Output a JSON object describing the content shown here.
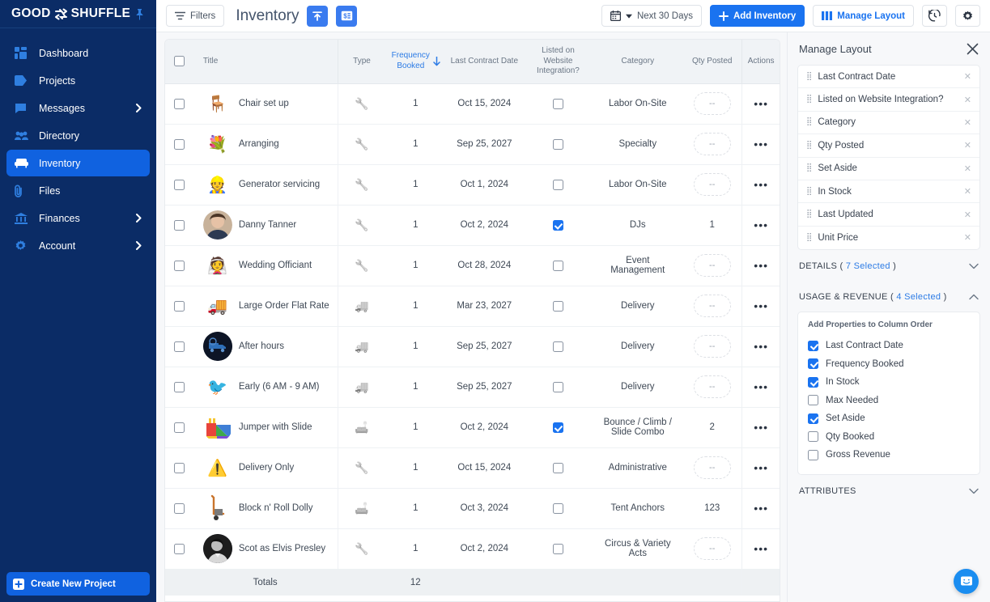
{
  "sidebar": {
    "brand": {
      "word1": "GOOD",
      "word2": "SHUFFLE",
      "pin_icon": "pin-icon"
    },
    "items": [
      {
        "label": "Dashboard",
        "icon": "dashboard-icon",
        "active": false,
        "chevron": false
      },
      {
        "label": "Projects",
        "icon": "tag-icon",
        "active": false,
        "chevron": false
      },
      {
        "label": "Messages",
        "icon": "message-icon",
        "active": false,
        "chevron": true
      },
      {
        "label": "Directory",
        "icon": "people-icon",
        "active": false,
        "chevron": true
      },
      {
        "label": "Inventory",
        "icon": "sofa-icon",
        "active": true,
        "chevron": false
      },
      {
        "label": "Files",
        "icon": "paperclip-icon",
        "active": false,
        "chevron": false
      },
      {
        "label": "Finances",
        "icon": "bank-icon",
        "active": false,
        "chevron": true
      },
      {
        "label": "Account",
        "icon": "gear-icon",
        "active": false,
        "chevron": true
      }
    ],
    "create_button": {
      "label": "Create New Project",
      "icon": "plus-square-icon"
    }
  },
  "topbar": {
    "filters_label": "Filters",
    "filters_icon": "filter-icon",
    "page_title": "Inventory",
    "export_icon": "upload-export-icon",
    "pricing_icon": "price-card-icon",
    "date_range_label": "Next 30 Days",
    "calendar_icon": "calendar-icon",
    "caret_icon": "caret-down-icon",
    "add_inventory_label": "Add Inventory",
    "add_icon": "plus-icon",
    "manage_layout_label": "Manage Layout",
    "manage_layout_icon": "columns-icon",
    "history_icon": "history-clock-icon",
    "settings_icon": "gear-icon"
  },
  "table": {
    "select_all_checked": false,
    "columns": [
      {
        "key": "select",
        "label": ""
      },
      {
        "key": "title",
        "label": "Title"
      },
      {
        "key": "type",
        "label": "Type"
      },
      {
        "key": "frequency_booked",
        "label": "Frequency Booked",
        "sorted": true,
        "sort_dir": "desc"
      },
      {
        "key": "last_contract_date",
        "label": "Last Contract Date"
      },
      {
        "key": "listed_on_website",
        "label": "Listed on Website Integration?"
      },
      {
        "key": "category",
        "label": "Category"
      },
      {
        "key": "qty_posted",
        "label": "Qty Posted"
      },
      {
        "key": "actions",
        "label": "Actions"
      }
    ],
    "rows": [
      {
        "selected": false,
        "thumb": "chair-icon",
        "thumb_style": "plain",
        "title": "Chair set up",
        "type_icon": "wrench-icon",
        "frequency_booked": "1",
        "last_contract_date": "Oct 15, 2024",
        "listed": false,
        "category": "Labor On-Site",
        "qty_posted": "--",
        "qty_empty": true
      },
      {
        "selected": false,
        "thumb": "flower-arranging-icon",
        "thumb_style": "plain",
        "title": "Arranging",
        "type_icon": "wrench-icon",
        "frequency_booked": "1",
        "last_contract_date": "Sep 25, 2027",
        "listed": false,
        "category": "Specialty",
        "qty_posted": "--",
        "qty_empty": true
      },
      {
        "selected": false,
        "thumb": "worker-wrench-icon",
        "thumb_style": "plain",
        "title": "Generator servicing",
        "type_icon": "wrench-icon",
        "frequency_booked": "1",
        "last_contract_date": "Oct 1, 2024",
        "listed": false,
        "category": "Labor On-Site",
        "qty_posted": "--",
        "qty_empty": true
      },
      {
        "selected": false,
        "thumb": "person-photo-icon",
        "thumb_style": "photo",
        "title": "Danny Tanner",
        "type_icon": "wrench-icon",
        "frequency_booked": "1",
        "last_contract_date": "Oct 2, 2024",
        "listed": true,
        "category": "DJs",
        "qty_posted": "1",
        "qty_empty": false
      },
      {
        "selected": false,
        "thumb": "wedding-couple-icon",
        "thumb_style": "plain",
        "title": "Wedding Officiant",
        "type_icon": "wrench-icon",
        "frequency_booked": "1",
        "last_contract_date": "Oct 28, 2024",
        "listed": false,
        "category": "Event Management",
        "qty_posted": "--",
        "qty_empty": true
      },
      {
        "selected": false,
        "thumb": "truck-icon",
        "thumb_style": "plain",
        "title": "Large Order Flat Rate",
        "type_icon": "delivery-truck-icon",
        "frequency_booked": "1",
        "last_contract_date": "Mar 23, 2027",
        "listed": false,
        "category": "Delivery",
        "qty_posted": "--",
        "qty_empty": true
      },
      {
        "selected": false,
        "thumb": "night-truck-icon",
        "thumb_style": "dark",
        "title": "After hours",
        "type_icon": "delivery-truck-icon",
        "frequency_booked": "1",
        "last_contract_date": "Sep 25, 2027",
        "listed": false,
        "category": "Delivery",
        "qty_posted": "--",
        "qty_empty": true
      },
      {
        "selected": false,
        "thumb": "early-bird-icon",
        "thumb_style": "plain",
        "title": "Early (6 AM - 9 AM)",
        "type_icon": "delivery-truck-icon",
        "frequency_booked": "1",
        "last_contract_date": "Sep 25, 2027",
        "listed": false,
        "category": "Delivery",
        "qty_posted": "--",
        "qty_empty": true
      },
      {
        "selected": false,
        "thumb": "bounce-house-icon",
        "thumb_style": "plain",
        "title": "Jumper with Slide",
        "type_icon": "furniture-icon",
        "frequency_booked": "1",
        "last_contract_date": "Oct 2, 2024",
        "listed": true,
        "category": "Bounce / Climb / Slide Combo",
        "qty_posted": "2",
        "qty_empty": false
      },
      {
        "selected": false,
        "thumb": "warning-icon",
        "thumb_style": "plain",
        "title": "Delivery Only",
        "type_icon": "wrench-icon",
        "frequency_booked": "1",
        "last_contract_date": "Oct 15, 2024",
        "listed": false,
        "category": "Administrative",
        "qty_posted": "--",
        "qty_empty": true
      },
      {
        "selected": false,
        "thumb": "hand-truck-icon",
        "thumb_style": "plain",
        "title": "Block n' Roll Dolly",
        "type_icon": "furniture-icon",
        "frequency_booked": "1",
        "last_contract_date": "Oct 3, 2024",
        "listed": false,
        "category": "Tent Anchors",
        "qty_posted": "123",
        "qty_empty": false
      },
      {
        "selected": false,
        "thumb": "elvis-photo-icon",
        "thumb_style": "photo-dark",
        "title": "Scot as Elvis Presley",
        "type_icon": "wrench-icon",
        "frequency_booked": "1",
        "last_contract_date": "Oct 2, 2024",
        "listed": false,
        "category": "Circus & Variety Acts",
        "qty_posted": "--",
        "qty_empty": true
      }
    ],
    "footer": {
      "label": "Totals",
      "frequency_total": "12"
    },
    "row_actions_icon": "more-horizontal-icon"
  },
  "panel": {
    "title": "Manage Layout",
    "close_icon": "close-icon",
    "column_order": [
      {
        "label": "Last Contract Date",
        "grip_icon": "drag-handle-icon",
        "remove_icon": "remove-icon"
      },
      {
        "label": "Listed on Website Integration?",
        "grip_icon": "drag-handle-icon",
        "remove_icon": "remove-icon"
      },
      {
        "label": "Category",
        "grip_icon": "drag-handle-icon",
        "remove_icon": "remove-icon"
      },
      {
        "label": "Qty Posted",
        "grip_icon": "drag-handle-icon",
        "remove_icon": "remove-icon"
      },
      {
        "label": "Set Aside",
        "grip_icon": "drag-handle-icon",
        "remove_icon": "remove-icon"
      },
      {
        "label": "In Stock",
        "grip_icon": "drag-handle-icon",
        "remove_icon": "remove-icon"
      },
      {
        "label": "Last Updated",
        "grip_icon": "drag-handle-icon",
        "remove_icon": "remove-icon"
      },
      {
        "label": "Unit Price",
        "grip_icon": "drag-handle-icon",
        "remove_icon": "remove-icon"
      }
    ],
    "sections": [
      {
        "name": "DETAILS",
        "count": "7 Selected",
        "expanded": false,
        "caret_icon": "chevron-down-icon"
      },
      {
        "name": "USAGE & REVENUE",
        "count": "4 Selected",
        "expanded": true,
        "caret_icon": "chevron-up-icon"
      }
    ],
    "props_title": "Add Properties to Column Order",
    "props": [
      {
        "label": "Last Contract Date",
        "checked": true
      },
      {
        "label": "Frequency Booked",
        "checked": true
      },
      {
        "label": "In Stock",
        "checked": true
      },
      {
        "label": "Max Needed",
        "checked": false
      },
      {
        "label": "Set Aside",
        "checked": true
      },
      {
        "label": "Qty Booked",
        "checked": false
      },
      {
        "label": "Gross Revenue",
        "checked": false
      }
    ],
    "attributes_section": {
      "name": "ATTRIBUTES",
      "caret_icon": "chevron-down-icon"
    }
  },
  "intercom": {
    "icon": "chat-bubble-icon"
  },
  "colors": {
    "sidebar_bg": "#0b2c66",
    "accent_blue": "#1a73f0",
    "nav_active": "#1062e0",
    "link_blue": "#2c7be5",
    "header_bg": "#f0f3f6",
    "page_bg": "#f7f8fa"
  }
}
